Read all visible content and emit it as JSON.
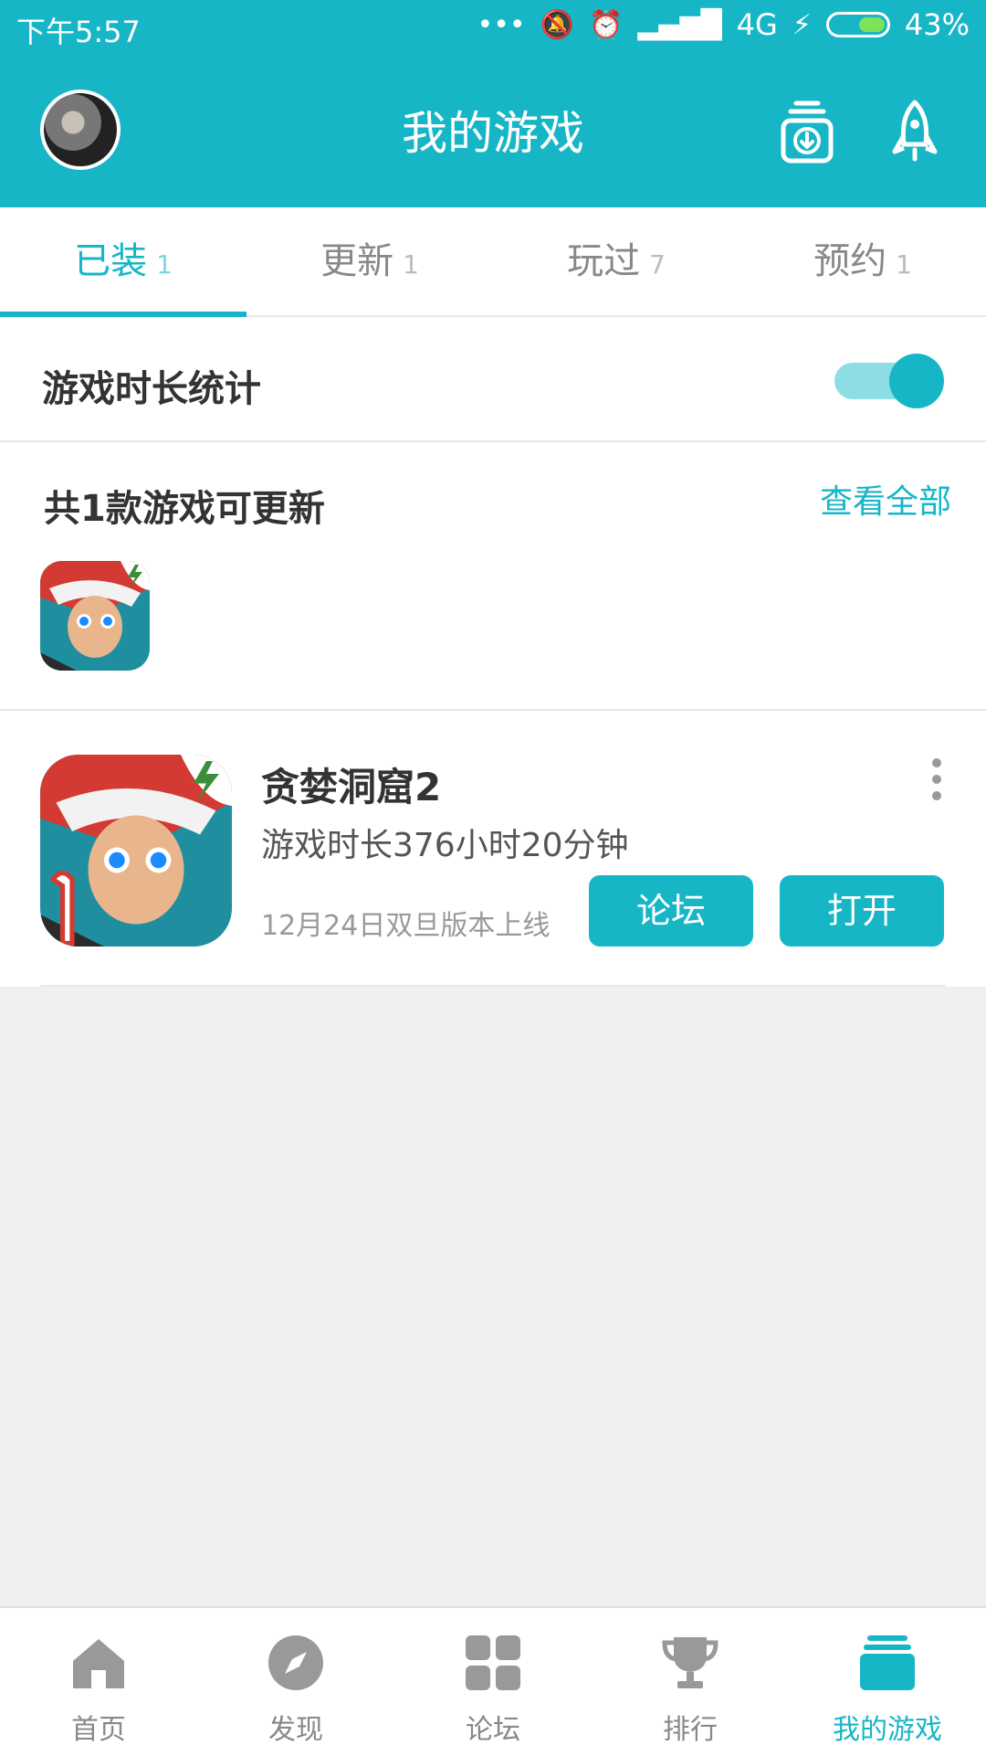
{
  "status_bar": {
    "time": "下午5:57",
    "network": "4G",
    "battery": "43%"
  },
  "header": {
    "title": "我的游戏",
    "download_icon": "download-box-icon",
    "rocket_icon": "rocket-icon"
  },
  "tabs": [
    {
      "label": "已装",
      "count": "1",
      "active": true
    },
    {
      "label": "更新",
      "count": "1",
      "active": false
    },
    {
      "label": "玩过",
      "count": "7",
      "active": false
    },
    {
      "label": "预约",
      "count": "1",
      "active": false
    }
  ],
  "playtime_stats": {
    "label": "游戏时长统计",
    "enabled": true
  },
  "updates": {
    "title": "共1款游戏可更新",
    "view_all": "查看全部"
  },
  "game": {
    "name": "贪婪洞窟2",
    "playtime": "游戏时长376小时20分钟",
    "note": "12月24日双旦版本上线",
    "forum_button": "论坛",
    "open_button": "打开"
  },
  "bottom_nav": [
    {
      "label": "首页",
      "icon": "home-icon",
      "active": false
    },
    {
      "label": "发现",
      "icon": "compass-icon",
      "active": false
    },
    {
      "label": "论坛",
      "icon": "grid-icon",
      "active": false
    },
    {
      "label": "排行",
      "icon": "trophy-icon",
      "active": false
    },
    {
      "label": "我的游戏",
      "icon": "games-stack-icon",
      "active": true
    }
  ],
  "colors": {
    "accent": "#17b6c6",
    "background": "#efefef"
  }
}
